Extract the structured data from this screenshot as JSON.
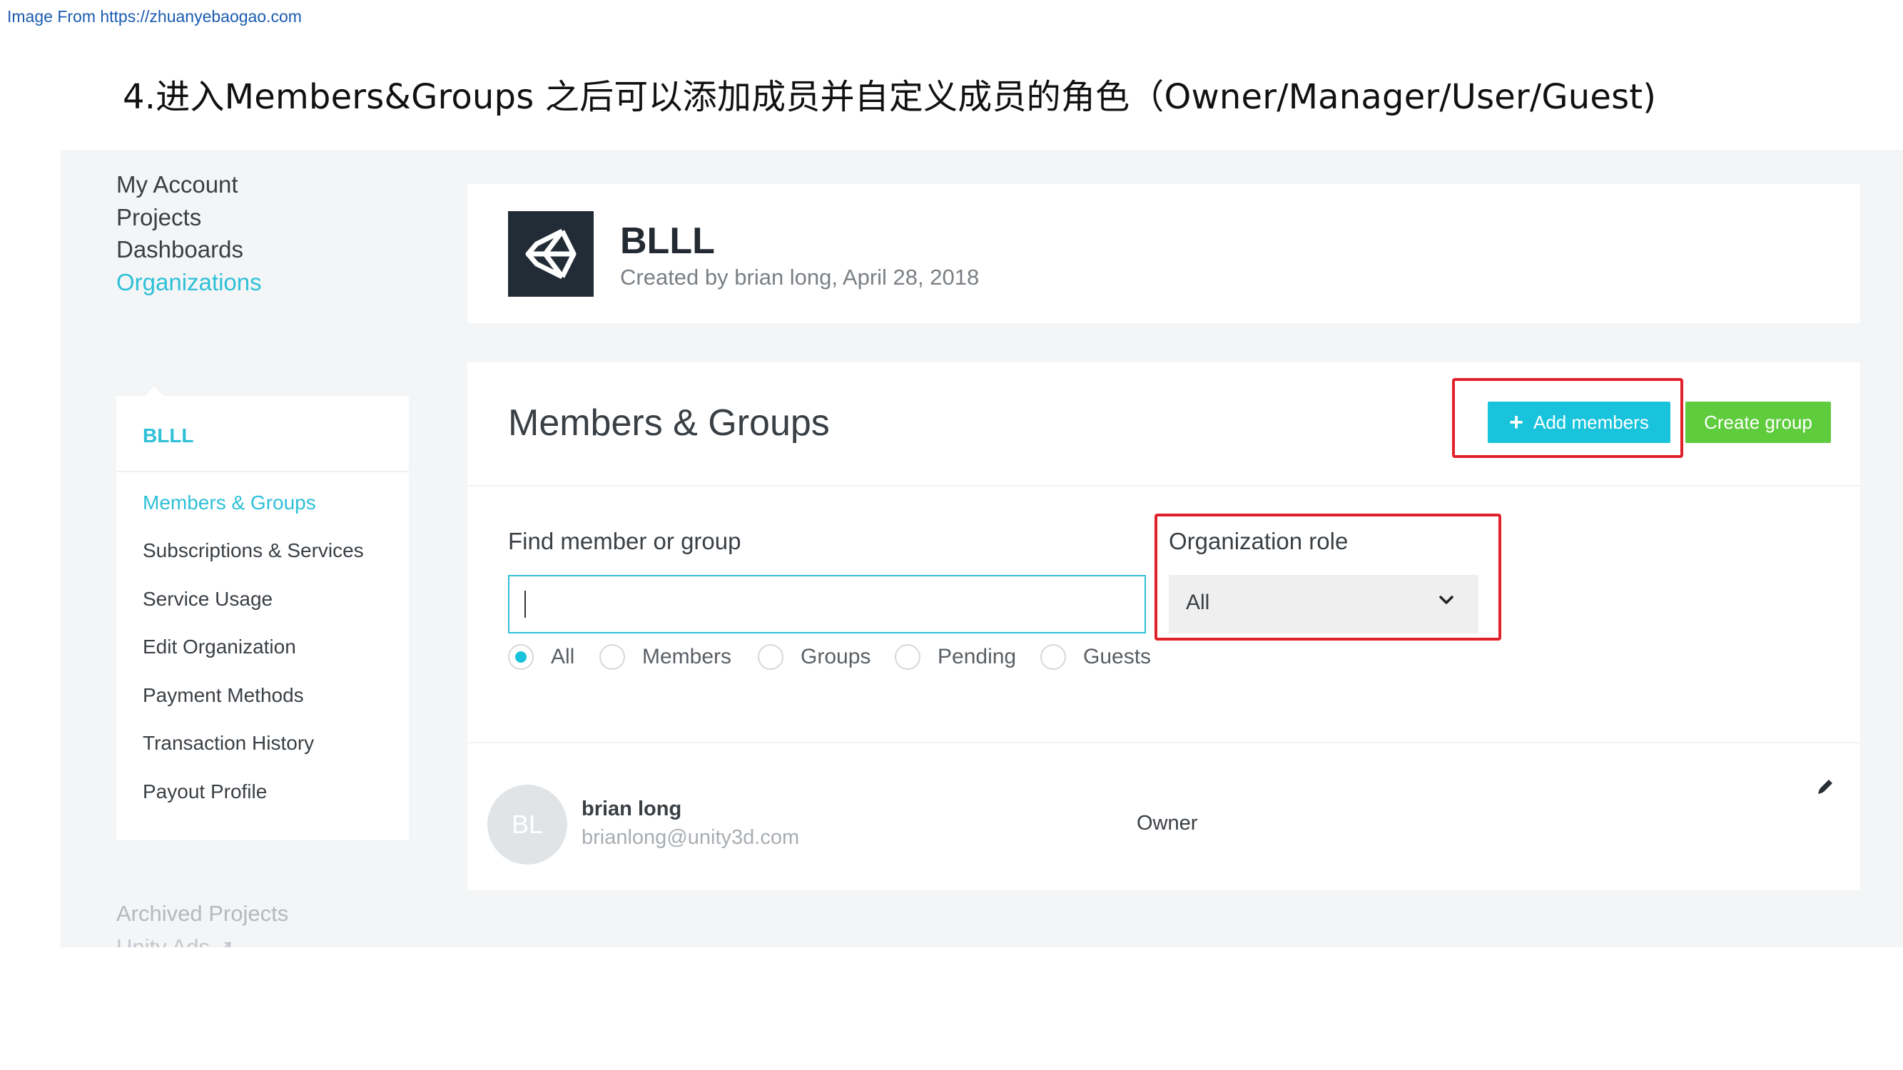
{
  "source_link": "Image From https://zhuanyebaogao.com",
  "slide_title": "4.进入Members&Groups 之后可以添加成员并自定义成员的角色（Owner/Manager/User/Guest)",
  "sidebar": {
    "top_items": [
      {
        "label": "My Account"
      },
      {
        "label": "Projects"
      },
      {
        "label": "Dashboards"
      },
      {
        "label": "Organizations"
      }
    ],
    "org_name": "BLLL",
    "org_items": [
      {
        "label": "Members & Groups"
      },
      {
        "label": "Subscriptions & Services"
      },
      {
        "label": "Service Usage"
      },
      {
        "label": "Edit Organization"
      },
      {
        "label": "Payment Methods"
      },
      {
        "label": "Transaction History"
      },
      {
        "label": "Payout Profile"
      }
    ],
    "archived": "Archived Projects",
    "unity_ads": "Unity Ads"
  },
  "org_header": {
    "title": "BLLL",
    "subtitle": "Created by brian long, April 28, 2018"
  },
  "members": {
    "title": "Members & Groups",
    "add_button": "Add members",
    "create_button": "Create group",
    "find_label": "Find member or group",
    "find_value": "",
    "role_label": "Organization role",
    "role_value": "All",
    "filters": [
      {
        "label": "All",
        "checked": true
      },
      {
        "label": "Members",
        "checked": false
      },
      {
        "label": "Groups",
        "checked": false
      },
      {
        "label": "Pending",
        "checked": false
      },
      {
        "label": "Guests",
        "checked": false
      }
    ],
    "list": [
      {
        "initials": "BL",
        "name": "brian long",
        "email": "brianlong@unity3d.com",
        "role": "Owner"
      }
    ]
  },
  "colors": {
    "accent": "#2ec0d8",
    "add_button": "#19c3dc",
    "create_button": "#5ecc3c",
    "highlight": "#e0202a"
  }
}
